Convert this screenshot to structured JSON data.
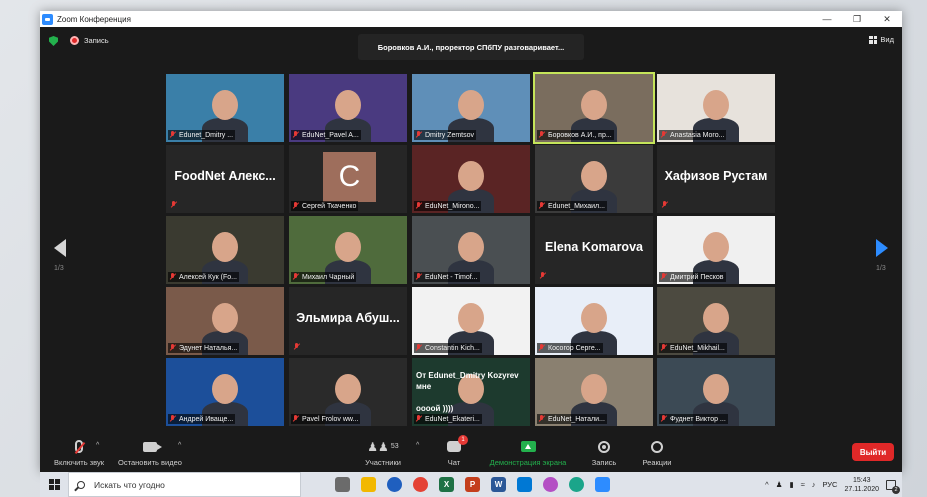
{
  "window": {
    "title": "Zoom Конференция"
  },
  "top": {
    "recording_label": "Запись",
    "talking_banner": "Боровков А.И., проректор СПбПУ разговаривает...",
    "view_label": "Вид"
  },
  "nav": {
    "page_left": "1/3",
    "page_right": "1/3"
  },
  "tiles": [
    {
      "label": "Edunet_Dmitry ...",
      "kind": "video",
      "bg": "#3a7fa8"
    },
    {
      "label": "EduNet_Pavel A...",
      "kind": "video",
      "bg": "#4a3a80"
    },
    {
      "label": "Dmitry Zemtsov",
      "kind": "video",
      "bg": "#5f8fb8"
    },
    {
      "label": "Боровков А.И., пр...",
      "kind": "video",
      "bg": "#7a6d5e",
      "active": true
    },
    {
      "label": "Anastasia Moro...",
      "kind": "video",
      "bg": "#e7e2dc"
    },
    {
      "big": "FoodNet  Алекс...",
      "kind": "name"
    },
    {
      "label": "Сергей Ткаченко",
      "kind": "avatar",
      "letter": "C"
    },
    {
      "label": "EduNet_Mirono...",
      "kind": "video",
      "bg": "#5a2424"
    },
    {
      "label": "Edunet_Михаил...",
      "kind": "video",
      "bg": "#3b3b3b"
    },
    {
      "big": "Хафизов Рустам",
      "kind": "name"
    },
    {
      "label": "Алексей Кук (Fo...",
      "kind": "video",
      "bg": "#3a3a30"
    },
    {
      "label": "Михаил Чарный",
      "kind": "video",
      "bg": "#4f6b3c"
    },
    {
      "label": "EduNet - Timof...",
      "kind": "video",
      "bg": "#4a4f52"
    },
    {
      "big": "Elena Komarova",
      "kind": "name"
    },
    {
      "label": "Дмитрий Песков",
      "kind": "video",
      "bg": "#f0f0f0"
    },
    {
      "label": "Эдунет Наталья...",
      "kind": "video",
      "bg": "#7a5a4a"
    },
    {
      "big": "Эльмира  Абуш...",
      "kind": "name"
    },
    {
      "label": "Constantin Kich...",
      "kind": "video",
      "bg": "#f2f2f2"
    },
    {
      "label": "Косогор Серге...",
      "kind": "video",
      "bg": "#e8eef8"
    },
    {
      "label": "EduNet_Mikhail...",
      "kind": "video",
      "bg": "#4c4a40"
    },
    {
      "label": "Андрей Иваще...",
      "kind": "video",
      "bg": "#1c4f9a"
    },
    {
      "label": "Pavel Frolov ww...",
      "kind": "video",
      "bg": "#2a2a2a"
    },
    {
      "label": "EduNet_Ekateri...",
      "kind": "video",
      "bg": "#1d3a2e",
      "overlay": "От Edunet_Dmitry Kozyrev\nмне\n\nоооой ))))"
    },
    {
      "label": "EduNet_Натали...",
      "kind": "video",
      "bg": "#8a8070"
    },
    {
      "label": "Фуднет Виктор ...",
      "kind": "video",
      "bg": "#3c4a55"
    }
  ],
  "toolbar": {
    "mute_label": "Включить звук",
    "video_label": "Остановить видео",
    "participants_count": "53",
    "participants_label": "Участники",
    "chat_label": "Чат",
    "chat_badge": "1",
    "share_label": "Демонстрация экрана",
    "record_label": "Запись",
    "reactions_label": "Реакции",
    "leave_label": "Выйти"
  },
  "taskbar": {
    "search_placeholder": "Искать что угодно",
    "lang": "РУС",
    "time": "15:43",
    "date": "27.11.2020",
    "notifications": "2"
  }
}
